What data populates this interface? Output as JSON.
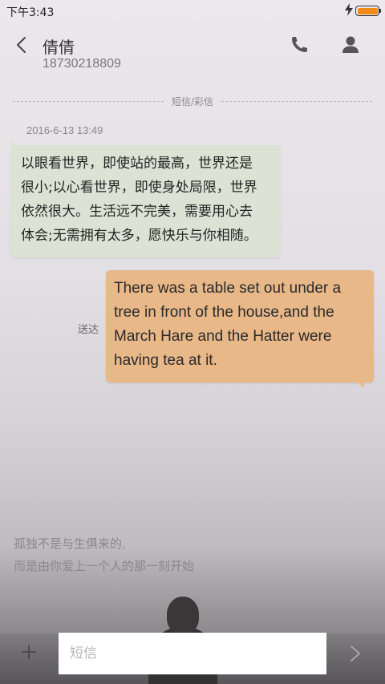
{
  "status_bar": {
    "time": "下午3:43",
    "battery_level": 1.0,
    "battery_color": "#f28a1a",
    "icons": [
      "flash-icon",
      "battery-icon"
    ]
  },
  "header": {
    "contact_name": "倩倩",
    "contact_number": "18730218809",
    "icons": [
      "back-arrow-icon",
      "phone-icon",
      "person-icon"
    ]
  },
  "thread": {
    "type_divider": "短信/彩信",
    "messages": [
      {
        "direction": "incoming",
        "timestamp": "2016-6-13 13:49",
        "lines": [
          "以眼看世界，即使站的最高，世界还是",
          "很小;以心看世界，即使身处局限，世界",
          "依然很大。生活远不完美，需要用心去",
          "体会;无需拥有太多，愿快乐与你相随。"
        ],
        "bubble_color": "#dde3d4"
      },
      {
        "direction": "outgoing",
        "status": "送达",
        "lines": [
          "There was a table set out under a",
          "tree in front of the house,and the",
          "March Hare and the Hatter were",
          "having tea at it."
        ],
        "bubble_color": "#e9b889"
      }
    ]
  },
  "wallpaper": {
    "poem_lines": [
      "孤独不是与生俱来的,",
      "而是由你爱上一个人的那一刻开始"
    ]
  },
  "composer": {
    "placeholder": "短信",
    "value": "",
    "icons": [
      "plus-icon",
      "send-arrow-icon"
    ]
  }
}
